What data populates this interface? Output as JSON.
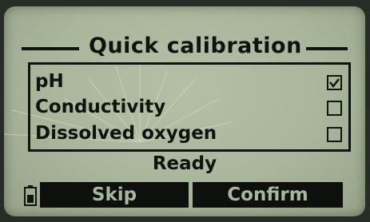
{
  "screen": {
    "title": "Quick calibration",
    "options": [
      {
        "label": "pH",
        "checked": true
      },
      {
        "label": "Conductivity",
        "checked": false
      },
      {
        "label": "Dissolved oxygen",
        "checked": false
      }
    ],
    "status": "Ready",
    "softkeys": {
      "left_label": "Skip",
      "right_label": "Confirm"
    },
    "colors": {
      "lcd_background": "#a9b69b",
      "lcd_ink": "#0f130f",
      "device_bezel": "#262c26"
    },
    "icons": {
      "status_icon": "battery-icon",
      "checked_icon": "check-mark-icon"
    }
  }
}
